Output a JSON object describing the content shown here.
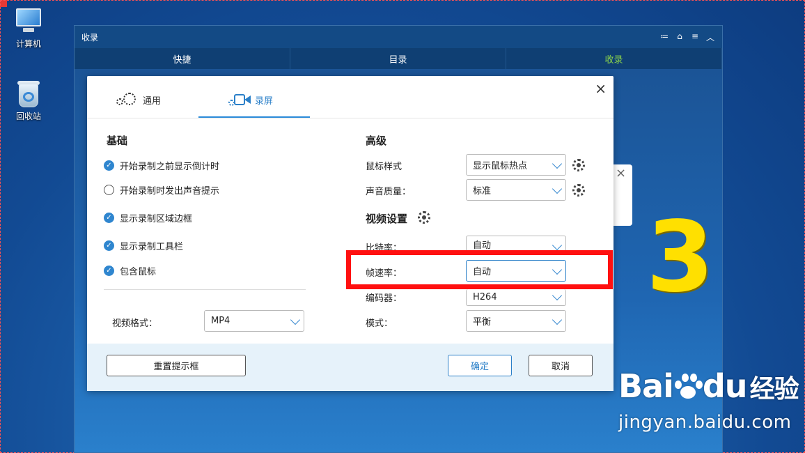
{
  "desktop": {
    "icons": [
      {
        "label": "计算机"
      },
      {
        "label": "回收站"
      }
    ]
  },
  "app": {
    "title": "收录",
    "title_controls": [
      "≔",
      "⌂",
      "≡",
      "︿"
    ],
    "tabs": [
      {
        "label": "快捷"
      },
      {
        "label": "目录"
      },
      {
        "label": "收录",
        "active": true
      }
    ]
  },
  "dialog": {
    "close": "×",
    "tabs": [
      {
        "label": "通用",
        "icon": "gears-icon"
      },
      {
        "label": "录屏",
        "icon": "camera-icon",
        "active": true
      }
    ],
    "basic": {
      "title": "基础",
      "options": [
        {
          "label": "开始录制之前显示倒计时",
          "checked": true
        },
        {
          "label": "开始录制时发出声音提示",
          "checked": false
        },
        {
          "label": "显示录制区域边框",
          "checked": true
        },
        {
          "label": "显示录制工具栏",
          "checked": true
        },
        {
          "label": "包含鼠标",
          "checked": true
        }
      ],
      "video_format_label": "视频格式：",
      "video_format_value": "MP4"
    },
    "advanced": {
      "title": "高级",
      "mouse_style_label": "鼠标样式",
      "mouse_style_value": "显示鼠标热点",
      "audio_quality_label": "声音质量：",
      "audio_quality_value": "标准",
      "video_settings_title": "视频设置",
      "bitrate_label": "比特率：",
      "bitrate_value": "自动",
      "framerate_label": "帧速率：",
      "framerate_value": "自动",
      "encoder_label": "编码器：",
      "encoder_value": "H264",
      "mode_label": "模式：",
      "mode_value": "平衡"
    },
    "footer": {
      "reset_label": "重置提示框",
      "ok_label": "确定",
      "cancel_label": "取消"
    }
  },
  "annotation": {
    "step_number": "3",
    "highlight_color": "#ff1010",
    "number_color": "#ffe000"
  },
  "watermark": {
    "brand_left": "Bai",
    "brand_right": "du",
    "brand_cn": "经验",
    "url": "jingyan.baidu.com"
  }
}
